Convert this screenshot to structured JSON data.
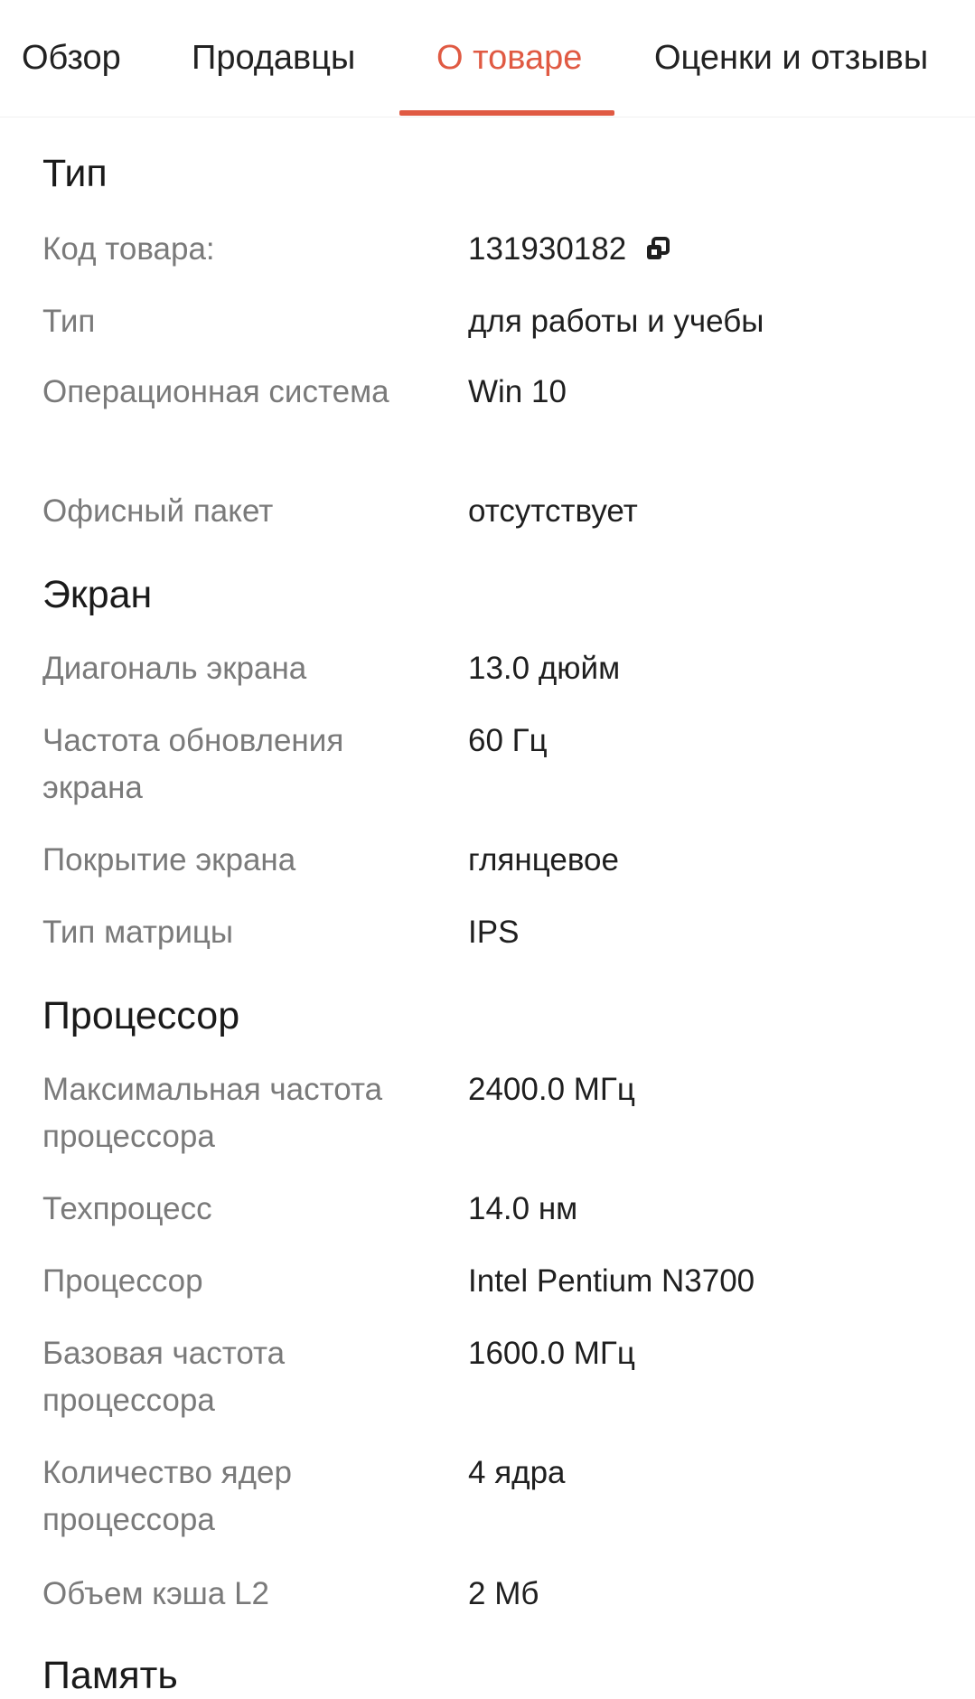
{
  "tabs": [
    {
      "label": "Обзор"
    },
    {
      "label": "Продавцы"
    },
    {
      "label": "О товаре"
    },
    {
      "label": "Оценки и отзывы"
    }
  ],
  "active_tab": "О товаре",
  "accent_color": "#e05a43",
  "sections": [
    {
      "title": "Тип",
      "rows": [
        {
          "label": "Код товара:",
          "value": "131930182",
          "icon": "copy-icon"
        },
        {
          "label": "Тип",
          "value": "для работы и учебы"
        },
        {
          "label": "Операционная система",
          "value": "Win 10"
        },
        {
          "label": "Офисный пакет",
          "value": "отсутствует"
        }
      ]
    },
    {
      "title": "Экран",
      "rows": [
        {
          "label": "Диагональ экрана",
          "value": "13.0 дюйм"
        },
        {
          "label": "Частота обновления экрана",
          "value": "60 Гц"
        },
        {
          "label": "Покрытие экрана",
          "value": "глянцевое"
        },
        {
          "label": "Тип матрицы",
          "value": "IPS"
        }
      ]
    },
    {
      "title": "Процессор",
      "rows": [
        {
          "label": "Максимальная частота процессора",
          "value": "2400.0 МГц"
        },
        {
          "label": "Техпроцесс",
          "value": "14.0 нм"
        },
        {
          "label": "Процессор",
          "value": "Intel Pentium N3700"
        },
        {
          "label": "Базовая частота процессора",
          "value": "1600.0 МГц"
        },
        {
          "label": "Количество ядер процессора",
          "value": "4 ядра"
        },
        {
          "label": "Объем кэша L2",
          "value": "2 Мб"
        }
      ]
    },
    {
      "title": "Память",
      "rows": []
    }
  ]
}
